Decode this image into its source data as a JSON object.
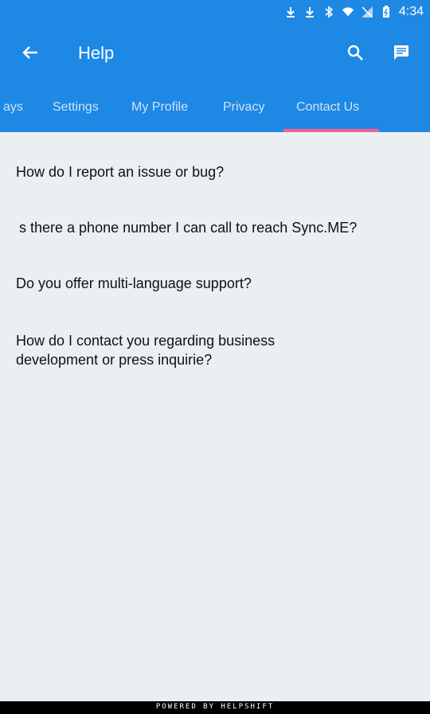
{
  "status_bar": {
    "time": "4:34",
    "icons": [
      "download-icon",
      "download-icon",
      "bluetooth-icon",
      "wifi-icon",
      "signal-icon",
      "battery-icon"
    ]
  },
  "app_bar": {
    "title": "Help",
    "back_icon": "arrow-left-icon",
    "search_icon": "search-icon",
    "chat_icon": "chat-icon"
  },
  "tabs": [
    {
      "label": "ays"
    },
    {
      "label": "Settings"
    },
    {
      "label": "My Profile"
    },
    {
      "label": "Privacy"
    },
    {
      "label": "Contact Us"
    }
  ],
  "questions": [
    {
      "text": "How do I report an issue or bug?"
    },
    {
      "text": "s there a phone number I can call to reach Sync.ME?"
    },
    {
      "text": "Do you offer multi-language support?"
    },
    {
      "text": "How do I contact you regarding business development or press inquirie?"
    }
  ],
  "footer": {
    "text": "POWERED BY HELPSHIFT"
  },
  "colors": {
    "primary": "#1e88e5",
    "indicator": "#f06292",
    "background": "#eceff1"
  }
}
